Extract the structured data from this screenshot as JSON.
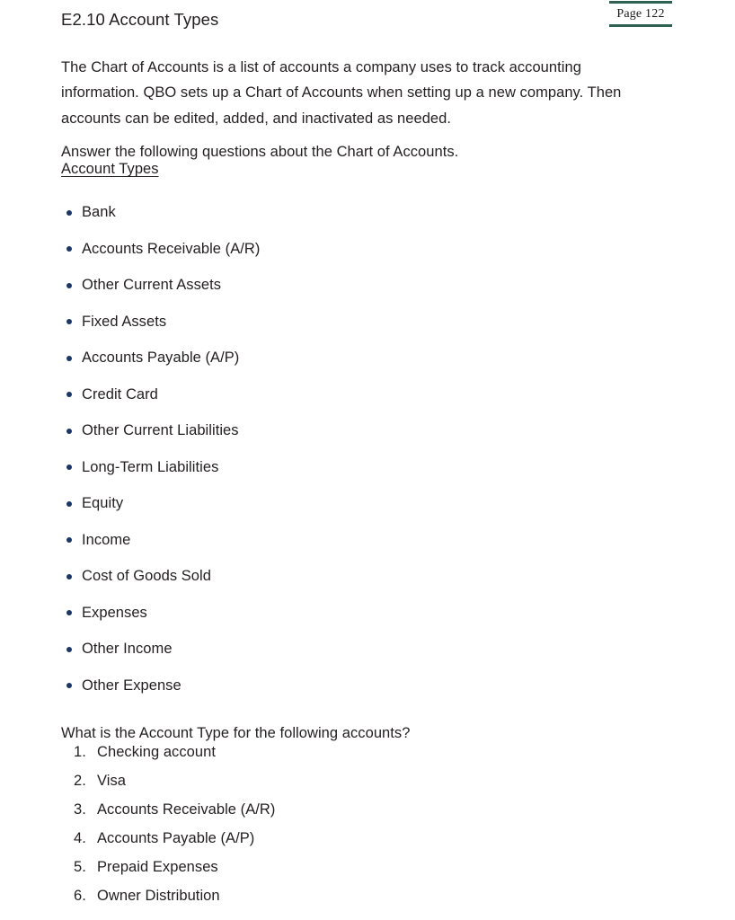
{
  "page_badge": {
    "label": "Page 122",
    "rule_color": "#2f6152"
  },
  "section": {
    "title": "E2.10 Account Types",
    "intro_paragraph": "The Chart of Accounts is a list of accounts a company uses to track accounting information. QBO sets up a Chart of Accounts when setting up a new company. Then accounts can be edited, added, and inactivated as needed.",
    "answer_instruction": "Answer the following questions about the Chart of Accounts.",
    "subheading": "Account Types",
    "question": "What is the Account Type for the following accounts?"
  },
  "colors": {
    "bullet": "#1b3766",
    "text": "#231f20",
    "rule": "#2f6152"
  },
  "account_types": [
    {
      "label": "Bank"
    },
    {
      "label": "Accounts Receivable (A/R)"
    },
    {
      "label": "Other Current Assets"
    },
    {
      "label": "Fixed Assets"
    },
    {
      "label": "Accounts Payable (A/P)"
    },
    {
      "label": "Credit Card"
    },
    {
      "label": "Other Current Liabilities"
    },
    {
      "label": "Long-Term Liabilities"
    },
    {
      "label": "Equity"
    },
    {
      "label": "Income"
    },
    {
      "label": "Cost of Goods Sold"
    },
    {
      "label": "Expenses"
    },
    {
      "label": "Other Income"
    },
    {
      "label": "Other Expense"
    }
  ],
  "questions": [
    {
      "number": "1.",
      "label": "Checking account"
    },
    {
      "number": "2.",
      "label": "Visa"
    },
    {
      "number": "3.",
      "label": "Accounts Receivable (A/R)"
    },
    {
      "number": "4.",
      "label": "Accounts Payable (A/P)"
    },
    {
      "number": "5.",
      "label": "Prepaid Expenses"
    },
    {
      "number": "6.",
      "label": "Owner Distribution"
    }
  ]
}
